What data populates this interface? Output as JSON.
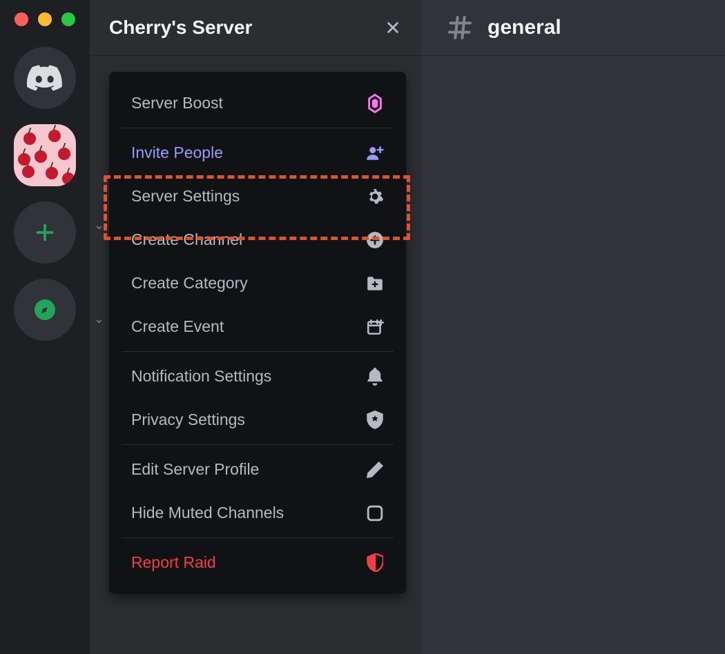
{
  "server": {
    "name": "Cherry's Server"
  },
  "channel": {
    "name": "general"
  },
  "dropdown": {
    "server_boost": "Server Boost",
    "invite_people": "Invite People",
    "server_settings": "Server Settings",
    "create_channel": "Create Channel",
    "create_category": "Create Category",
    "create_event": "Create Event",
    "notification_settings": "Notification Settings",
    "privacy_settings": "Privacy Settings",
    "edit_server_profile": "Edit Server Profile",
    "hide_muted_channels": "Hide Muted Channels",
    "report_raid": "Report Raid"
  },
  "icons": {
    "boost": "boost-gem-icon",
    "invite": "person-plus-icon",
    "settings": "gear-icon",
    "channel": "circle-plus-icon",
    "category": "folder-plus-icon",
    "event": "calendar-plus-icon",
    "notification": "bell-icon",
    "privacy": "shield-star-icon",
    "profile": "pencil-icon",
    "hide": "checkbox-empty-icon",
    "raid": "shield-alert-icon"
  },
  "colors": {
    "invite_accent": "#949cf7",
    "danger": "#f23f43",
    "boost_pink": "#ff73fa",
    "annotation": "#d9552f"
  }
}
